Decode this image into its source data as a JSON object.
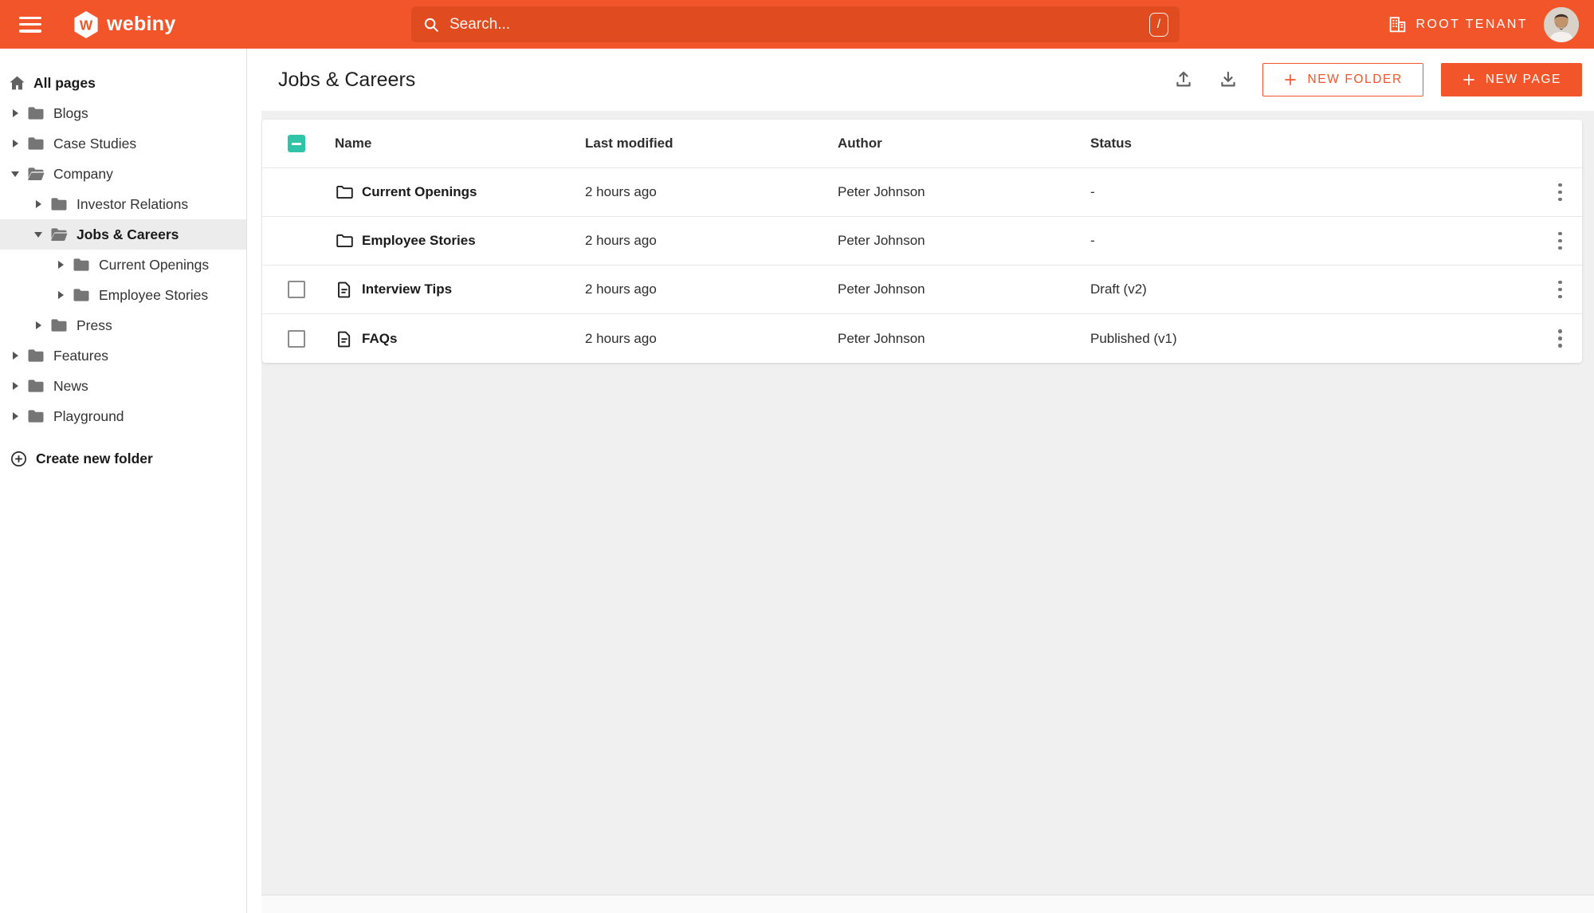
{
  "topbar": {
    "logo_text": "webiny",
    "search_placeholder": "Search...",
    "search_shortcut": "/",
    "tenant_label": "ROOT TENANT",
    "icons": [
      "menu-icon",
      "search-icon",
      "building-icon",
      "avatar"
    ]
  },
  "sidebar": {
    "items": [
      {
        "label": "All pages",
        "icon": "home-icon",
        "level": 0,
        "caret": "none",
        "bold": true,
        "selected": false
      },
      {
        "label": "Blogs",
        "icon": "folder-icon",
        "level": 0,
        "caret": "collapsed",
        "bold": false,
        "selected": false
      },
      {
        "label": "Case Studies",
        "icon": "folder-icon",
        "level": 0,
        "caret": "collapsed",
        "bold": false,
        "selected": false
      },
      {
        "label": "Company",
        "icon": "folder-open-icon",
        "level": 0,
        "caret": "expanded",
        "bold": false,
        "selected": false
      },
      {
        "label": "Investor Relations",
        "icon": "folder-icon",
        "level": 1,
        "caret": "collapsed",
        "bold": false,
        "selected": false
      },
      {
        "label": "Jobs & Careers",
        "icon": "folder-open-icon",
        "level": 1,
        "caret": "expanded",
        "bold": true,
        "selected": true
      },
      {
        "label": "Current Openings",
        "icon": "folder-icon",
        "level": 2,
        "caret": "collapsed",
        "bold": false,
        "selected": false
      },
      {
        "label": "Employee Stories",
        "icon": "folder-icon",
        "level": 2,
        "caret": "collapsed",
        "bold": false,
        "selected": false
      },
      {
        "label": "Press",
        "icon": "folder-icon",
        "level": 1,
        "caret": "collapsed",
        "bold": false,
        "selected": false
      },
      {
        "label": "Features",
        "icon": "folder-icon",
        "level": 0,
        "caret": "collapsed",
        "bold": false,
        "selected": false
      },
      {
        "label": "News",
        "icon": "folder-icon",
        "level": 0,
        "caret": "collapsed",
        "bold": false,
        "selected": false
      },
      {
        "label": "Playground",
        "icon": "folder-icon",
        "level": 0,
        "caret": "collapsed",
        "bold": false,
        "selected": false
      }
    ],
    "create_folder_label": "Create new folder"
  },
  "main": {
    "title": "Jobs & Careers",
    "actions": {
      "upload": "upload-icon",
      "download": "download-icon"
    },
    "new_folder_label": "NEW FOLDER",
    "new_page_label": "NEW PAGE"
  },
  "table": {
    "header_checkbox": "indeterminate",
    "headers": [
      "Name",
      "Last modified",
      "Author",
      "Status"
    ],
    "rows": [
      {
        "name": "Current Openings",
        "type": "folder",
        "checkbox": "none",
        "last_modified": "2 hours ago",
        "author": "Peter Johnson",
        "status": "-"
      },
      {
        "name": "Employee Stories",
        "type": "folder",
        "checkbox": "none",
        "last_modified": "2 hours ago",
        "author": "Peter Johnson",
        "status": "-"
      },
      {
        "name": "Interview Tips",
        "type": "page",
        "checkbox": "unchecked",
        "last_modified": "2 hours ago",
        "author": "Peter Johnson",
        "status": "Draft (v2)"
      },
      {
        "name": "FAQs",
        "type": "page",
        "checkbox": "unchecked",
        "last_modified": "2 hours ago",
        "author": "Peter Johnson",
        "status": "Published (v1)"
      }
    ]
  },
  "colors": {
    "topbar_orange": "#f2552a",
    "search_orange": "#e04b20",
    "accent_orange": "#f2552a",
    "checkbox_teal": "#2fc3a7",
    "main_background": "#f0f0f0",
    "sidebar_selected": "#ececec"
  }
}
